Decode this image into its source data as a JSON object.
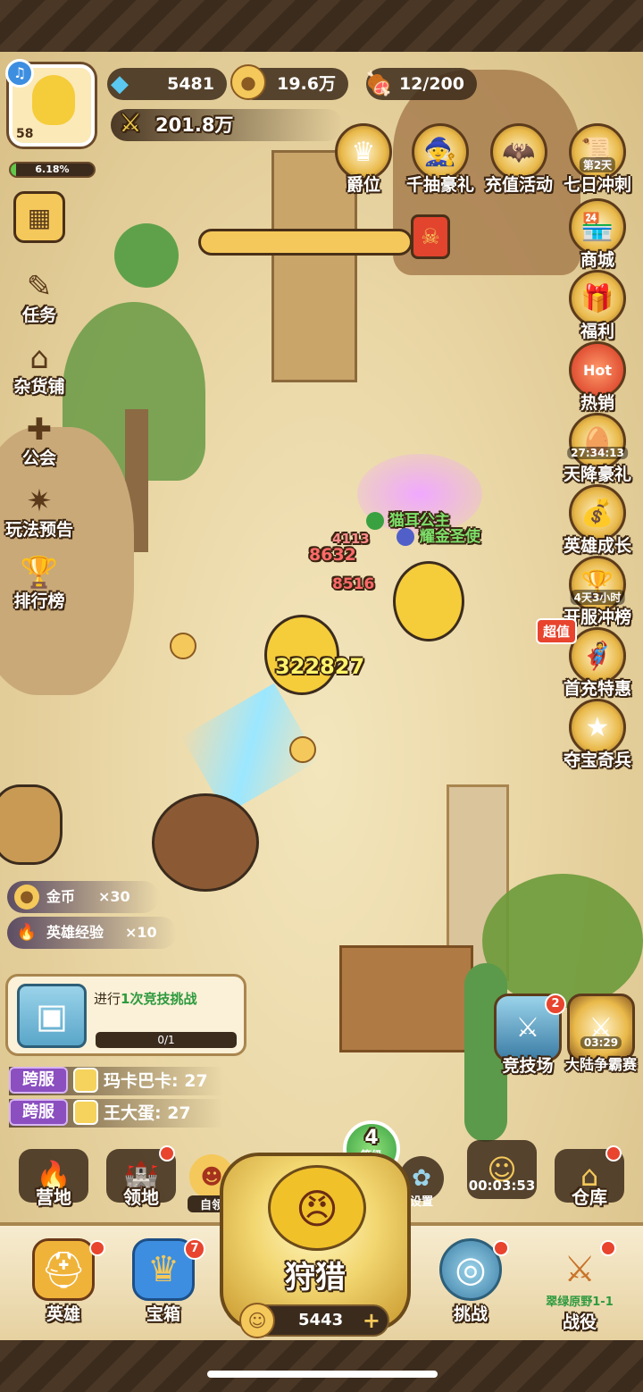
{
  "player": {
    "level": "58",
    "exp_percent": "6.18%",
    "exp_fraction": 0.0618
  },
  "resources": {
    "diamonds": "5481",
    "gold": "19.6万",
    "stamina": "12/200",
    "power": "201.8万"
  },
  "events_top": [
    {
      "label": "爵位",
      "icon": "rank-crown-icon"
    },
    {
      "label": "千抽豪礼",
      "icon": "wizard-icon"
    },
    {
      "label": "充值活动",
      "icon": "bat-icon"
    },
    {
      "label": "七日冲刺",
      "tag": "第2天",
      "icon": "scroll-icon"
    }
  ],
  "events_right": [
    {
      "label": "商城",
      "icon": "shop-icon"
    },
    {
      "label": "福利",
      "icon": "gift-icon"
    },
    {
      "label": "热销",
      "tag": "Hot",
      "icon": "hot-icon"
    },
    {
      "label": "天降豪礼",
      "tag": "27:34:13",
      "icon": "egg-icon"
    },
    {
      "label": "英雄成长",
      "icon": "treasure-icon"
    },
    {
      "label": "开服冲榜",
      "tag": "4天3小时",
      "icon": "trophy-icon"
    },
    {
      "label": "首充特惠",
      "tag": "超值",
      "icon": "hero-icon"
    },
    {
      "label": "夺宝奇兵",
      "icon": "wheel-icon"
    }
  ],
  "left_menu": [
    {
      "label": "",
      "icon": "grid-icon"
    },
    {
      "label": "任务",
      "icon": "task-icon"
    },
    {
      "label": "杂货铺",
      "icon": "store-icon"
    },
    {
      "label": "公会",
      "icon": "guild-icon"
    },
    {
      "label": "玩法预告",
      "icon": "preview-icon"
    },
    {
      "label": "排行榜",
      "icon": "trophy-icon"
    }
  ],
  "battle": {
    "allies": [
      "猫耳公主",
      "耀金圣使"
    ],
    "damage_main": "322827",
    "damage_small": [
      "4113",
      "8632",
      "8516"
    ]
  },
  "rewards": [
    {
      "label": "金币",
      "amount": "×30"
    },
    {
      "label": "英雄经验",
      "amount": "×10"
    }
  ],
  "quest": {
    "prefix": "进行",
    "highlight": "1次竞技挑战",
    "progress": "0/1",
    "progress_fraction": 0
  },
  "cross_server": [
    {
      "badge": "跨服",
      "text": "玛卡巴卡: 27"
    },
    {
      "badge": "跨服",
      "text": "王大蛋: 27"
    }
  ],
  "right_battle": [
    {
      "label": "竞技场",
      "badge": "2"
    },
    {
      "label": "大陆争霸赛",
      "timer": "03:29"
    }
  ],
  "nav": {
    "camp": "营地",
    "territory": "领地",
    "auto": "自领",
    "level_num": "4",
    "level_label": "等级",
    "settings": "设置",
    "timer": "00:03:53",
    "warehouse": "仓库"
  },
  "dock": {
    "hero": "英雄",
    "chest": "宝箱",
    "chest_badge": "7",
    "hunt": "狩猎",
    "hunt_coins": "5443",
    "challenge": "挑战",
    "campaign": "战役",
    "campaign_stage": "翠绿原野1-1"
  },
  "colors": {
    "accent_gold": "#f4c85a",
    "badge_red": "#e8442e",
    "exp_green": "#62c84a",
    "cross_purple": "#8b4fc0"
  }
}
